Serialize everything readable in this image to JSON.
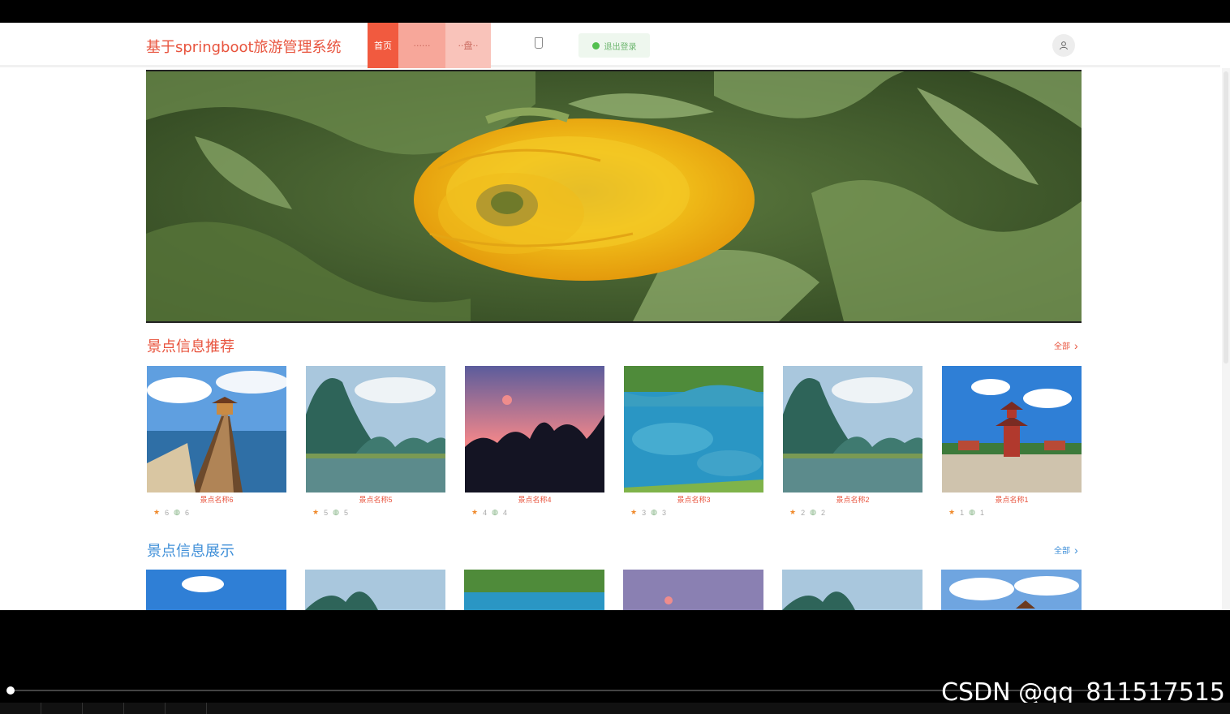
{
  "header": {
    "logo_text": "基于springboot旅游管理系统",
    "nav": [
      {
        "label": "首页"
      },
      {
        "label": "······"
      },
      {
        "label": "··盘··"
      }
    ],
    "status_label": "退出登录"
  },
  "sections": [
    {
      "title": "景点信息推荐",
      "more_label": "全部",
      "cards": [
        {
          "name": "景点名称6",
          "likes": "6",
          "comments": "6",
          "scene": "pier"
        },
        {
          "name": "景点名称5",
          "likes": "5",
          "comments": "5",
          "scene": "karst"
        },
        {
          "name": "景点名称4",
          "likes": "4",
          "comments": "4",
          "scene": "sunset"
        },
        {
          "name": "景点名称3",
          "likes": "3",
          "comments": "3",
          "scene": "lake"
        },
        {
          "name": "景点名称2",
          "likes": "2",
          "comments": "2",
          "scene": "karst"
        },
        {
          "name": "景点名称1",
          "likes": "1",
          "comments": "1",
          "scene": "pagoda"
        }
      ]
    },
    {
      "title": "景点信息展示",
      "more_label": "全部",
      "cards": [
        {
          "scene": "sky"
        },
        {
          "scene": "karst"
        },
        {
          "scene": "lake"
        },
        {
          "scene": "sunset"
        },
        {
          "scene": "karst"
        },
        {
          "scene": "pier"
        }
      ]
    }
  ],
  "watermark": "CSDN @qq_811517515",
  "colors": {
    "brand": "#e8543e",
    "accent_blue": "#3f8fd8",
    "nav_active": "#f15a3f"
  },
  "icons": {
    "avatar": "user-icon",
    "more": "chevron-right-icon",
    "like": "star-icon",
    "comment": "comment-icon"
  }
}
